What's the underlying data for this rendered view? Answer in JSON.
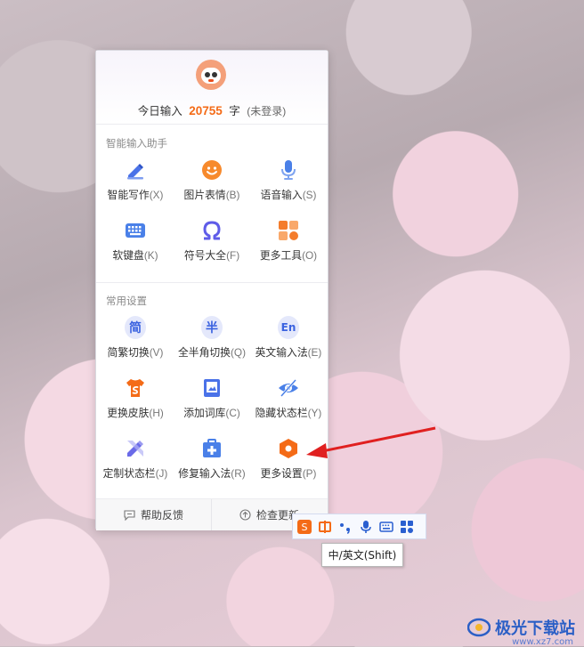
{
  "header": {
    "today_prefix": "今日输入",
    "count": "20755",
    "unit": "字",
    "login_status": "(未登录)"
  },
  "sections": {
    "assistant_title": "智能输入助手",
    "settings_title": "常用设置"
  },
  "assistant_items": [
    {
      "label": "智能写作",
      "key": "(X)",
      "icon": "pen-icon",
      "color": "#4a72e8"
    },
    {
      "label": "图片表情",
      "key": "(B)",
      "icon": "smiley-icon",
      "color": "#f78a2c"
    },
    {
      "label": "语音输入",
      "key": "(S)",
      "icon": "microphone-icon",
      "color": "#4a80e8"
    },
    {
      "label": "软键盘",
      "key": "(K)",
      "icon": "keyboard-icon",
      "color": "#4a80e8"
    },
    {
      "label": "符号大全",
      "key": "(F)",
      "icon": "omega-icon",
      "color": "#5f5ce8"
    },
    {
      "label": "更多工具",
      "key": "(O)",
      "icon": "tools-grid-icon",
      "color": "#f47c2c"
    }
  ],
  "settings_items": [
    {
      "label": "简繁切换",
      "key": "(V)",
      "icon": "simplified-traditional-icon",
      "glyph": "简"
    },
    {
      "label": "全半角切换",
      "key": "(Q)",
      "icon": "full-half-width-icon",
      "glyph": "半"
    },
    {
      "label": "英文输入法",
      "key": "(E)",
      "icon": "english-input-icon",
      "glyph": "En"
    },
    {
      "label": "更换皮肤",
      "key": "(H)",
      "icon": "skin-shirt-icon"
    },
    {
      "label": "添加词库",
      "key": "(C)",
      "icon": "dictionary-book-icon"
    },
    {
      "label": "隐藏状态栏",
      "key": "(Y)",
      "icon": "hide-eye-icon"
    },
    {
      "label": "定制状态栏",
      "key": "(J)",
      "icon": "customize-pencil-icon"
    },
    {
      "label": "修复输入法",
      "key": "(R)",
      "icon": "repair-kit-icon"
    },
    {
      "label": "更多设置",
      "key": "(P)",
      "icon": "settings-hexagon-icon"
    }
  ],
  "footer": {
    "feedback": "帮助反馈",
    "check_update": "检查更新"
  },
  "tooltip": "中/英文(Shift)",
  "watermark": {
    "text": "极光下载站",
    "sub": "www.xz7.com"
  },
  "colors": {
    "accent_orange": "#f46b17",
    "accent_blue": "#3b63e0",
    "annotation_arrow": "#e02020"
  }
}
